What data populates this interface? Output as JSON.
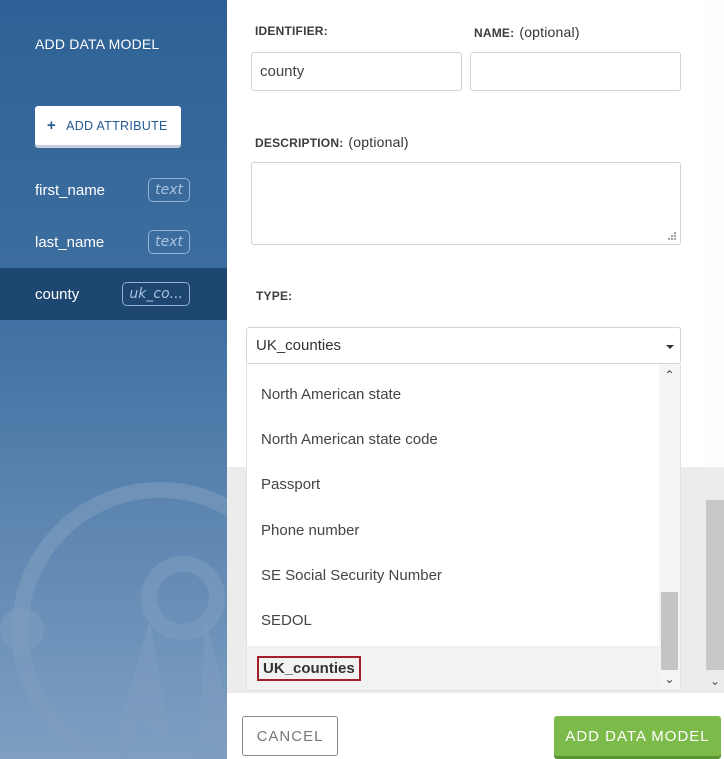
{
  "sidebar": {
    "title": "ADD DATA MODEL",
    "add_attribute_icon": "+",
    "add_attribute_label": "ADD ATTRIBUTE",
    "attributes": [
      {
        "name": "first_name",
        "type": "text",
        "active": false
      },
      {
        "name": "last_name",
        "type": "text",
        "active": false
      },
      {
        "name": "county",
        "type": "uk_co...",
        "active": true
      }
    ]
  },
  "form": {
    "identifier_label": "IDENTIFIER:",
    "identifier_value": "county",
    "name_label": "NAME:",
    "name_optional": "(optional)",
    "name_value": "",
    "description_label": "DESCRIPTION:",
    "description_optional": "(optional)",
    "description_value": "",
    "type_label": "TYPE:",
    "type_selected": "UK_counties",
    "type_options_visible": [
      "North American state",
      "North American state code",
      "Passport",
      "Phone number",
      "SE Social Security Number",
      "SEDOL",
      "UK_counties"
    ]
  },
  "footer": {
    "cancel_label": "CANCEL",
    "add_label": "ADD DATA MODEL"
  },
  "colors": {
    "sidebar_top": "#2e6195",
    "sidebar_active": "#1d4670",
    "primary_button": "#7cbb4a",
    "selected_outline": "#a3202a"
  },
  "icons": {
    "select_caret": "caret-down-icon",
    "scroll_up": "chevron-up-icon",
    "scroll_down": "chevron-down-icon",
    "decoration": "badge-ribbon-icon"
  }
}
